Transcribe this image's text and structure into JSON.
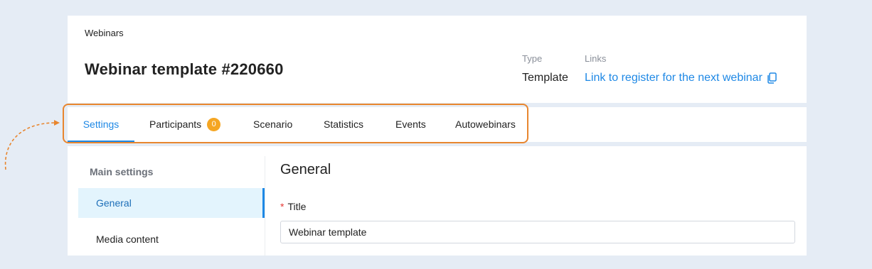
{
  "header": {
    "breadcrumb": "Webinars",
    "title": "Webinar template #220660",
    "type_label": "Type",
    "type_value": "Template",
    "links_label": "Links",
    "link_text": "Link to register for the next webinar"
  },
  "tabs": [
    {
      "label": "Settings",
      "active": true
    },
    {
      "label": "Participants",
      "badge": "0"
    },
    {
      "label": "Scenario"
    },
    {
      "label": "Statistics"
    },
    {
      "label": "Events"
    },
    {
      "label": "Autowebinars"
    }
  ],
  "sidebar": {
    "heading": "Main settings",
    "items": [
      {
        "label": "General",
        "active": true
      },
      {
        "label": "Media content"
      }
    ]
  },
  "main": {
    "section_title": "General",
    "title_field": {
      "required_mark": "*",
      "label": "Title",
      "value": "Webinar template"
    }
  },
  "colors": {
    "accent": "#1e88e5",
    "badge": "#f5a623",
    "highlight_outline": "#e8862f",
    "background": "#e5ecf5"
  }
}
